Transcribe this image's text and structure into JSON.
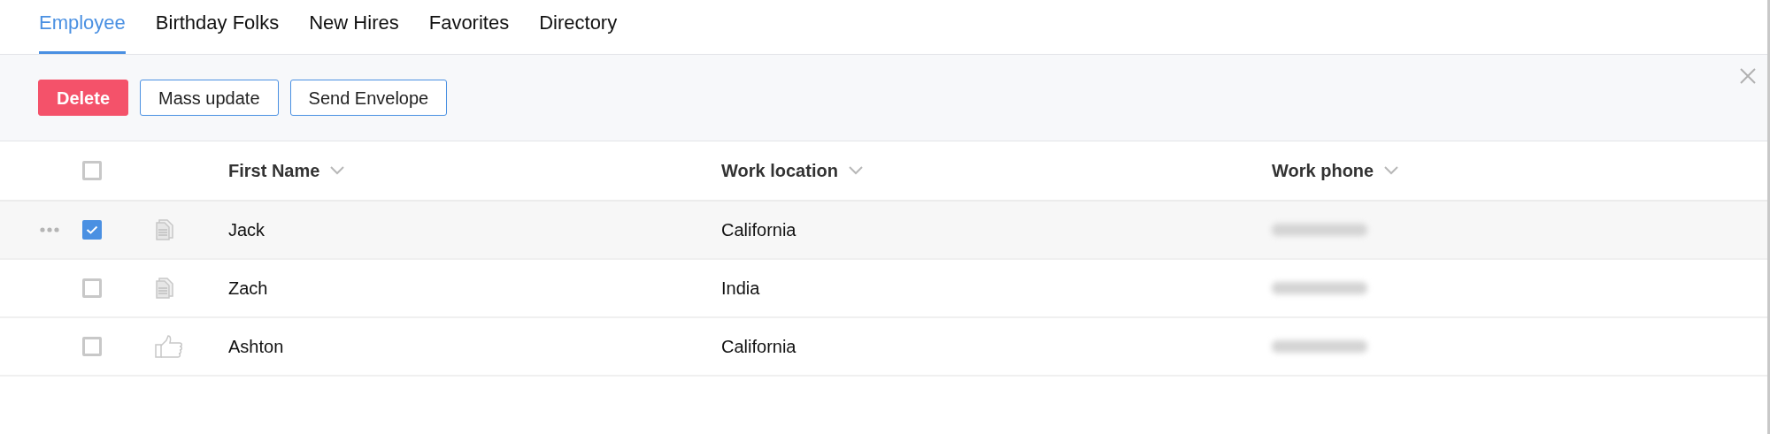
{
  "tabs": [
    {
      "label": "Employee",
      "selected": true
    },
    {
      "label": "Birthday Folks",
      "selected": false
    },
    {
      "label": "New Hires",
      "selected": false
    },
    {
      "label": "Favorites",
      "selected": false
    },
    {
      "label": "Directory",
      "selected": false
    }
  ],
  "toolbar": {
    "buttons": [
      {
        "label": "Delete",
        "kind": "danger"
      },
      {
        "label": "Mass update",
        "kind": "outline"
      },
      {
        "label": "Send Envelope",
        "kind": "outline"
      }
    ]
  },
  "table": {
    "select_all": {
      "checked": false
    },
    "columns": [
      "First Name",
      "Work location",
      "Work phone"
    ],
    "rows": [
      {
        "highlighted": true,
        "checked": true,
        "kind": "note",
        "first_name": "Jack",
        "work_location": "California"
      },
      {
        "highlighted": false,
        "checked": false,
        "kind": "note",
        "first_name": "Zach",
        "work_location": "India"
      },
      {
        "highlighted": false,
        "checked": false,
        "kind": "liked",
        "first_name": "Ashton",
        "work_location": "California"
      }
    ]
  }
}
